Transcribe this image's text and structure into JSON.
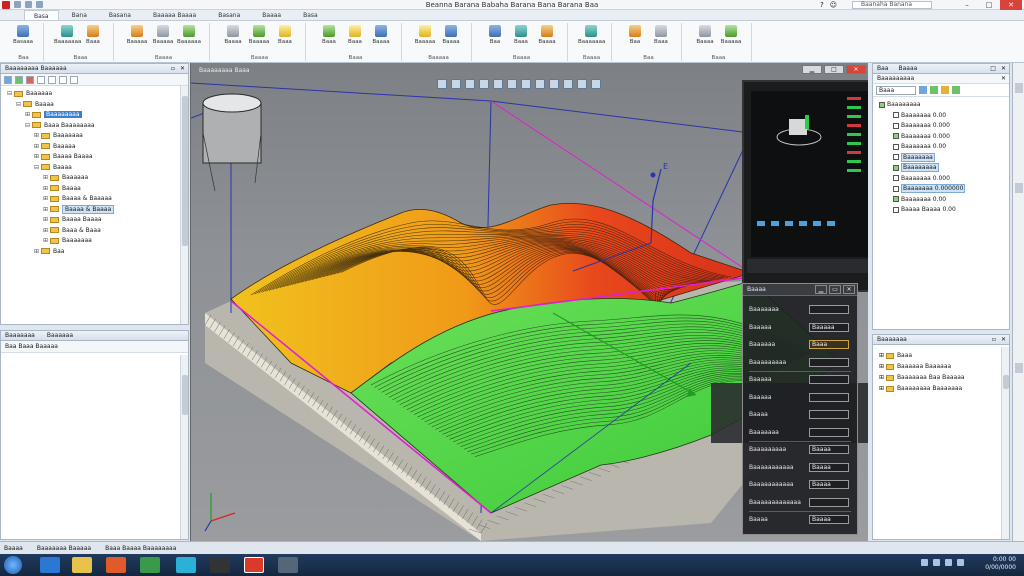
{
  "window": {
    "title": "Beanna Barana Babaha Barana Bana Barana Baa",
    "search_placeholder": "Baanaha Banana",
    "min": "–",
    "max": "□",
    "close": "✕"
  },
  "ribbon": {
    "tabs": [
      "Basa",
      "Bana",
      "Basana",
      "Baaaaa Baaaa",
      "Basana",
      "Baaaa",
      "Basa"
    ],
    "groups": [
      {
        "label": "Baa",
        "buttons": [
          "Basaaa"
        ]
      },
      {
        "label": "Baaa",
        "buttons": [
          "Baaaaaaa",
          "Baaa"
        ]
      },
      {
        "label": "Baaaa",
        "buttons": [
          "Baaaaa",
          "Baaaaa",
          "Baaaaaa"
        ]
      },
      {
        "label": "Baaaa",
        "buttons": [
          "Baaaa",
          "Baaaaa",
          "Baaa"
        ]
      },
      {
        "label": "Baaa",
        "buttons": [
          "Baaa",
          "Baaa",
          "Baaaa"
        ]
      },
      {
        "label": "Baaaaa",
        "buttons": [
          "Baaaaa",
          "Baaaa"
        ]
      },
      {
        "label": "Baaaa",
        "buttons": [
          "Baa",
          "Baaa",
          "Baaaa"
        ]
      },
      {
        "label": "Baaaa",
        "buttons": [
          "Baaaaaaa"
        ]
      },
      {
        "label": "Baa",
        "buttons": [
          "Baa",
          "Baaa"
        ]
      },
      {
        "label": "Baaa",
        "buttons": [
          "Baaaa",
          "Baaaaa"
        ]
      }
    ]
  },
  "model_tree": {
    "title": "Baaaaaaaa Baaaaaa",
    "rows": [
      {
        "label": "Baaaaaa",
        "indent": 0,
        "toggle": "⊟"
      },
      {
        "label": "Baaaa",
        "indent": 1,
        "toggle": "⊟"
      },
      {
        "label": "Baaaaaaaa",
        "indent": 2,
        "toggle": "⊞",
        "selected": true
      },
      {
        "label": "Baaa Baaaaaaaa",
        "indent": 2,
        "toggle": "⊟"
      },
      {
        "label": "Baaaaaaa",
        "indent": 3,
        "toggle": "⊞"
      },
      {
        "label": "Baaaaa",
        "indent": 3,
        "toggle": "⊞"
      },
      {
        "label": "Baaaa Baaaa",
        "indent": 3,
        "toggle": "⊞"
      },
      {
        "label": "Baaaa",
        "indent": 3,
        "toggle": "⊟"
      },
      {
        "label": "Baaaaaa",
        "indent": 4,
        "toggle": "⊞"
      },
      {
        "label": "Baaaa",
        "indent": 4,
        "toggle": "⊞"
      },
      {
        "label": "Baaaa & Baaaaa",
        "indent": 4,
        "toggle": "⊞"
      },
      {
        "label": "Baaaa & Baaaa",
        "indent": 4,
        "toggle": "⊞",
        "highlight": true
      },
      {
        "label": "Baaaa Baaaa",
        "indent": 4,
        "toggle": "⊞"
      },
      {
        "label": "Baaa & Baaa",
        "indent": 4,
        "toggle": "⊞"
      },
      {
        "label": "Baaaaaaa",
        "indent": 4,
        "toggle": "⊞"
      },
      {
        "label": "Baa",
        "indent": 3,
        "toggle": "⊞"
      }
    ]
  },
  "lower_left": {
    "tabs": [
      "Baaaaaaa",
      "Baaaaaa"
    ],
    "toolbar": "Baa  Baaa  Baaaaa"
  },
  "viewport": {
    "label": "Baaaaaaaa Baaa",
    "axis_labels": {
      "y_label": "E"
    },
    "win_min": "▁",
    "win_max": "□",
    "win_close": "✕"
  },
  "properties_dialog": {
    "title": "Baaaa",
    "fields": [
      {
        "label": "Baaaaaaa",
        "value": ""
      },
      {
        "label": "Baaaaa",
        "value": "Baaaaa"
      },
      {
        "label": "Baaaaaa",
        "value": "Baaa"
      },
      {
        "label": "Baaaaaaaaa",
        "value": ""
      },
      {
        "label": "Baaaaa",
        "value": ""
      },
      {
        "label": "Baaaaa",
        "value": ""
      },
      {
        "label": "Baaaa",
        "value": ""
      },
      {
        "label": "Baaaaaaa",
        "value": ""
      },
      {
        "label": "Baaaaaaaaa",
        "value": "Baaaa"
      },
      {
        "label": "Baaaaaaaaaaa",
        "value": "Baaaa"
      },
      {
        "label": "Baaaaaaaaaaa",
        "value": "Baaaa"
      },
      {
        "label": "Baaaaaaaaaaaaa",
        "value": ""
      },
      {
        "label": "Baaaa",
        "value": "Baaaa"
      }
    ]
  },
  "right_top": {
    "tabs": [
      "Baa",
      "Baaaa"
    ],
    "header": "Baaaaaaaaa",
    "filter": "Baaa",
    "rows": [
      {
        "label": "Baaaaaaaa",
        "indent": 0
      },
      {
        "label": "Baaaaaaa  0.00",
        "indent": 1
      },
      {
        "label": "Baaaaaaa  0.000",
        "indent": 1
      },
      {
        "label": "Baaaaaaa  0.000",
        "indent": 1
      },
      {
        "label": "Baaaaaaa  0.00",
        "indent": 1
      },
      {
        "label": "Baaaaaaa",
        "indent": 1,
        "highlight": true
      },
      {
        "label": "Baaaaaaaa",
        "indent": 1,
        "highlight": true
      },
      {
        "label": "Baaaaaaa  0.000",
        "indent": 1
      },
      {
        "label": "Baaaaaaa  0.000000",
        "indent": 1,
        "highlight": true
      },
      {
        "label": "Baaaaaaa  0.00",
        "indent": 1
      },
      {
        "label": "Baaaa Baaaa  0.00",
        "indent": 1
      }
    ]
  },
  "right_bottom": {
    "header": "Baaaaaaa",
    "rows": [
      {
        "label": "Baaa"
      },
      {
        "label": "Baaaaaa Baaaaaa"
      },
      {
        "label": "Baaaaaaa Baa Baaaaa"
      },
      {
        "label": "Baaaaaaaa Baaaaaaa"
      }
    ]
  },
  "status_bar": {
    "items": [
      "Baaaa",
      "Baaaaaaa Baaaaa",
      "Baaa Baaaa Baaaaaaaa"
    ]
  },
  "taskbar": {
    "time": "0:00 00",
    "date": "0/00/0000"
  },
  "colors": {
    "accent": "#3b7fd0",
    "surface_high": "#e0381a",
    "surface_low": "#3fcf3a",
    "surface_mid": "#e8b81e",
    "axis_blue": "#2233aa",
    "highlight_edge": "#e020d0"
  }
}
